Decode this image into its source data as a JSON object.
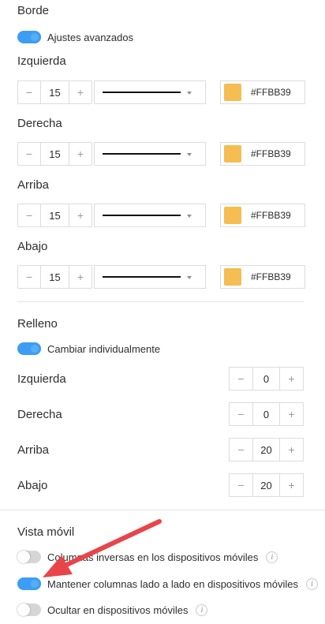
{
  "border": {
    "title": "Borde",
    "advanced_toggle": {
      "label": "Ajustes avanzados",
      "on": true
    },
    "sides": [
      {
        "label": "Izquierda",
        "width": "15",
        "color": "#FFBB39",
        "color_text": "#FFBB39"
      },
      {
        "label": "Derecha",
        "width": "15",
        "color": "#FFBB39",
        "color_text": "#FFBB39"
      },
      {
        "label": "Arriba",
        "width": "15",
        "color": "#FFBB39",
        "color_text": "#FFBB39"
      },
      {
        "label": "Abajo",
        "width": "15",
        "color": "#FFBB39",
        "color_text": "#FFBB39"
      }
    ],
    "minus_symbol": "−",
    "plus_symbol": "+"
  },
  "padding": {
    "title": "Relleno",
    "individual_toggle": {
      "label": "Cambiar individualmente",
      "on": true
    },
    "sides": [
      {
        "label": "Izquierda",
        "value": "0"
      },
      {
        "label": "Derecha",
        "value": "0"
      },
      {
        "label": "Arriba",
        "value": "20"
      },
      {
        "label": "Abajo",
        "value": "20"
      }
    ]
  },
  "mobile": {
    "title": "Vista móvil",
    "options": [
      {
        "label": "Columnas inversas en los dispositivos móviles",
        "on": false,
        "info_icon": "i"
      },
      {
        "label": "Mantener columnas lado a lado en dispositivos móviles",
        "on": true,
        "info_icon": "i"
      },
      {
        "label": "Ocultar en dispositivos móviles",
        "on": false,
        "info_icon": "i"
      }
    ]
  },
  "colors": {
    "accent": "#3D9DF3",
    "swatch": "#F5BD52",
    "arrow": "#E8454A"
  }
}
